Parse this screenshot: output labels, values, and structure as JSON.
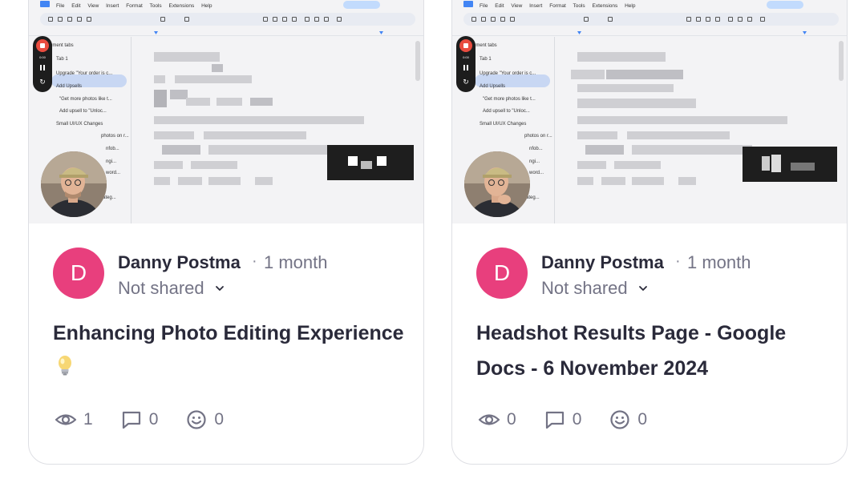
{
  "cards": [
    {
      "author": "Danny Postma",
      "author_initial": "D",
      "separator": "·",
      "time_ago": "1 month",
      "privacy": "Not shared",
      "title": "Enhancing Photo Editing Experience",
      "title_emoji": "lightbulb-icon",
      "views": "1",
      "comments": "0",
      "reactions": "0",
      "thumbnail": {
        "menu": [
          "File",
          "Edit",
          "View",
          "Insert",
          "Format",
          "Tools",
          "Extensions",
          "Help"
        ],
        "recording_time": "0:00",
        "outline": [
          "ument tabs",
          "Tab 1",
          "Upgrade \"Your order is c...",
          "Add Upsells",
          "\"Get more photos like t...",
          "Add upsell to \"Unloc...",
          "Small UI/UX Changes",
          "photos on r...",
          "nfob...",
          "ngi...",
          "word...",
          "Add body text to categ..."
        ]
      }
    },
    {
      "author": "Danny Postma",
      "author_initial": "D",
      "separator": "·",
      "time_ago": "1 month",
      "privacy": "Not shared",
      "title": "Headshot Results Page - Google Docs - 6 November 2024",
      "title_emoji": "",
      "views": "0",
      "comments": "0",
      "reactions": "0",
      "thumbnail": {
        "menu": [
          "File",
          "Edit",
          "View",
          "Insert",
          "Format",
          "Tools",
          "Extensions",
          "Help"
        ],
        "recording_time": "0:00",
        "outline": [
          "ument tabs",
          "Tab 1",
          "Upgrade \"Your order is c...",
          "Add Upsells",
          "\"Get more photos like t...",
          "Add upsell to \"Unloc...",
          "Small UI/UX Changes",
          "photos on r...",
          "nfob...",
          "ngi...",
          "word...",
          "Add body text to categ..."
        ]
      }
    }
  ],
  "colors": {
    "avatar": "#e83f7d",
    "text_primary": "#2a2a3a",
    "text_secondary": "#737385",
    "card_border": "#dedfe4",
    "redaction": "#1e1e1e"
  }
}
